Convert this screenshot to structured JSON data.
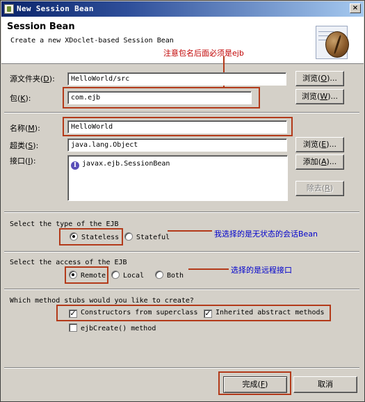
{
  "window": {
    "title": "New Session Bean",
    "close_glyph": "×"
  },
  "header": {
    "title": "Session Bean",
    "description": "Create a new XDoclet-based Session Bean",
    "icon": "coffee-bean-icon"
  },
  "annotations": {
    "package_note": "注意包名后面必须是ejb",
    "stateless_note": "我选择的是无状态的会话Bean",
    "remote_note": "选择的是远程接口",
    "red_color": "#b33a1a",
    "blue_color": "#0000cc"
  },
  "form": {
    "source_folder": {
      "label": "源文件夹",
      "mnemonic": "D",
      "value": "HelloWorld/src",
      "browse": "浏览",
      "browse_key": "O"
    },
    "package": {
      "label": "包",
      "mnemonic": "K",
      "value": "com.ejb",
      "browse": "浏览",
      "browse_key": "W"
    },
    "name": {
      "label": "名称",
      "mnemonic": "M",
      "value": "HelloWorld"
    },
    "superclass": {
      "label": "超类",
      "mnemonic": "S",
      "value": "java.lang.Object",
      "browse": "浏览",
      "browse_key": "E"
    },
    "interfaces": {
      "label": "接口",
      "mnemonic": "I",
      "items": [
        "javax.ejb.SessionBean"
      ],
      "add": "添加",
      "add_key": "A",
      "remove": "除去",
      "remove_key": "R"
    }
  },
  "ejb_type": {
    "heading": "Select the type of the EJB",
    "options": [
      "Stateless",
      "Stateful"
    ],
    "selected": "Stateless"
  },
  "ejb_access": {
    "heading": "Select the access of the EJB",
    "options": [
      "Remote",
      "Local",
      "Both"
    ],
    "selected": "Remote"
  },
  "stubs": {
    "heading": "Which method stubs would you like to create?",
    "options": [
      {
        "label": "Constructors from superclass",
        "checked": true
      },
      {
        "label": "Inherited abstract methods",
        "checked": true
      },
      {
        "label": "ejbCreate() method",
        "checked": false
      }
    ]
  },
  "footer": {
    "finish": "完成",
    "finish_key": "F",
    "cancel": "取消"
  }
}
